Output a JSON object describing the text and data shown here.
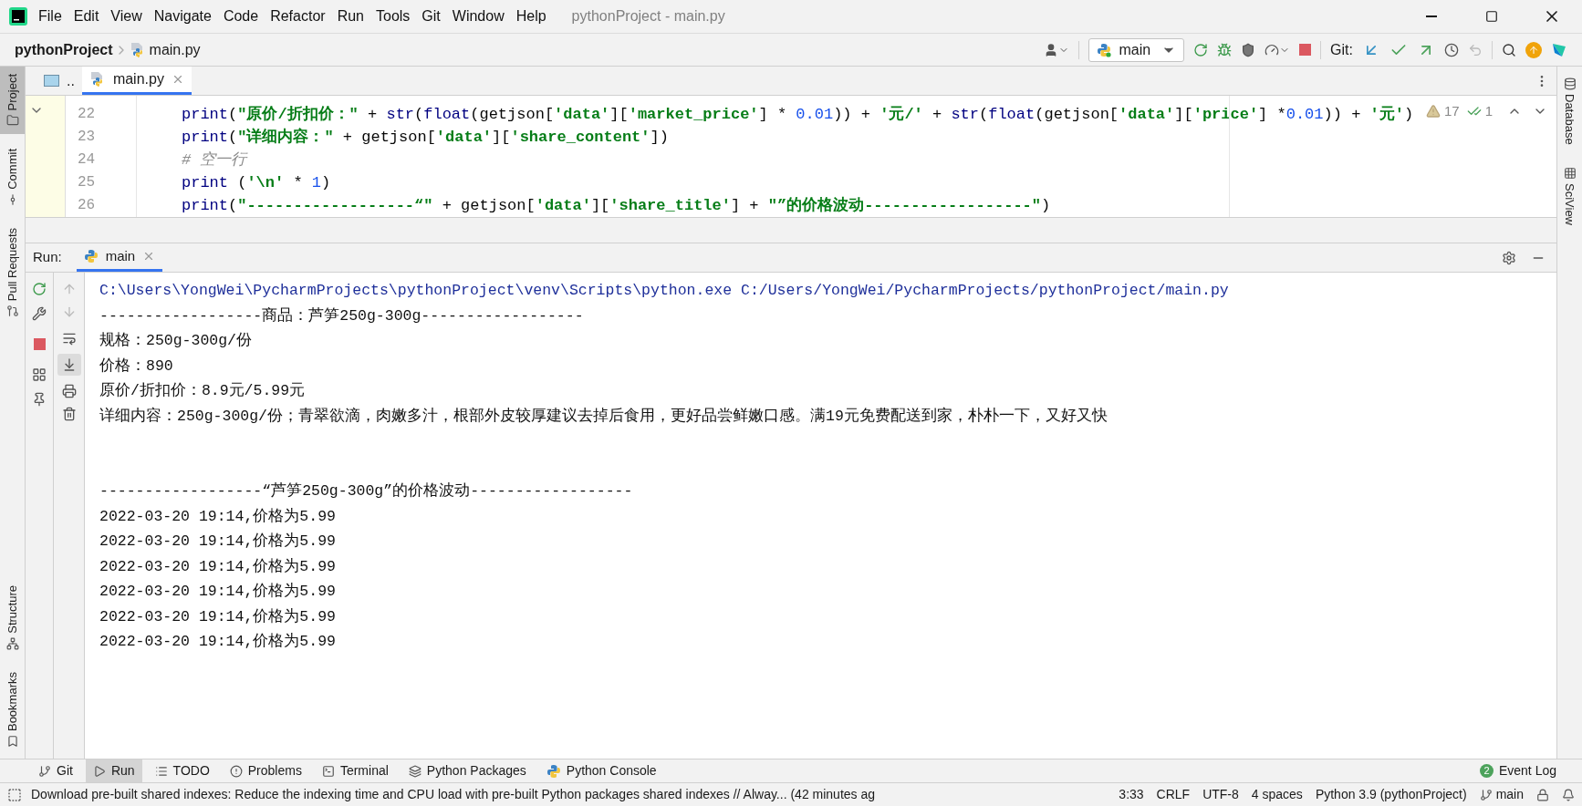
{
  "window": {
    "title": "pythonProject - main.py"
  },
  "menu": [
    "File",
    "Edit",
    "View",
    "Navigate",
    "Code",
    "Refactor",
    "Run",
    "Tools",
    "Git",
    "Window",
    "Help"
  ],
  "breadcrumb": {
    "project": "pythonProject",
    "file": "main.py"
  },
  "toolbar": {
    "run_config": "main",
    "git_label": "Git:"
  },
  "left_tool_windows": {
    "top": [
      {
        "label": "Project",
        "selected": true
      },
      {
        "label": "Commit",
        "selected": false
      },
      {
        "label": "Pull Requests",
        "selected": false
      }
    ],
    "bottom": [
      {
        "label": "Structure",
        "selected": false
      },
      {
        "label": "Bookmarks",
        "selected": false
      }
    ]
  },
  "right_tool_windows": [
    {
      "label": "Database"
    },
    {
      "label": "SciView"
    }
  ],
  "editor": {
    "tabs": [
      {
        "label": "..",
        "selected": false,
        "closable": false
      },
      {
        "label": "main.py",
        "selected": true,
        "closable": true
      }
    ],
    "inspections": {
      "warnings": "17",
      "typos": "1"
    },
    "lines": [
      {
        "number": "22",
        "tokens": [
          {
            "kind": "builtin",
            "text": "print"
          },
          {
            "kind": "plain",
            "text": "("
          },
          {
            "kind": "string",
            "text": "\"原价/折扣价：\""
          },
          {
            "kind": "plain",
            "text": " + "
          },
          {
            "kind": "builtin",
            "text": "str"
          },
          {
            "kind": "plain",
            "text": "("
          },
          {
            "kind": "builtin",
            "text": "float"
          },
          {
            "kind": "plain",
            "text": "(getjson["
          },
          {
            "kind": "string",
            "text": "'data'"
          },
          {
            "kind": "plain",
            "text": "]["
          },
          {
            "kind": "string",
            "text": "'market_price'"
          },
          {
            "kind": "plain",
            "text": "] * "
          },
          {
            "kind": "number",
            "text": "0.01"
          },
          {
            "kind": "plain",
            "text": ")) + "
          },
          {
            "kind": "string",
            "text": "'元/'"
          },
          {
            "kind": "plain",
            "text": " + "
          },
          {
            "kind": "builtin",
            "text": "str"
          },
          {
            "kind": "plain",
            "text": "("
          },
          {
            "kind": "builtin",
            "text": "float"
          },
          {
            "kind": "plain",
            "text": "(getjson["
          },
          {
            "kind": "string",
            "text": "'data'"
          },
          {
            "kind": "plain",
            "text": "]["
          },
          {
            "kind": "string",
            "text": "'price'"
          },
          {
            "kind": "plain",
            "text": "] *"
          },
          {
            "kind": "number",
            "text": "0.01"
          },
          {
            "kind": "plain",
            "text": ")) + "
          },
          {
            "kind": "string",
            "text": "'元'"
          },
          {
            "kind": "plain",
            "text": ")"
          }
        ]
      },
      {
        "number": "23",
        "tokens": [
          {
            "kind": "builtin",
            "text": "print"
          },
          {
            "kind": "plain",
            "text": "("
          },
          {
            "kind": "string",
            "text": "\"详细内容：\""
          },
          {
            "kind": "plain",
            "text": " + getjson["
          },
          {
            "kind": "string",
            "text": "'data'"
          },
          {
            "kind": "plain",
            "text": "]["
          },
          {
            "kind": "string",
            "text": "'share_content'"
          },
          {
            "kind": "plain",
            "text": "])"
          }
        ]
      },
      {
        "number": "24",
        "tokens": [
          {
            "kind": "comment",
            "text": "# 空一行"
          }
        ]
      },
      {
        "number": "25",
        "tokens": [
          {
            "kind": "builtin",
            "text": "print"
          },
          {
            "kind": "plain",
            "text": " ("
          },
          {
            "kind": "string",
            "text": "'\\n'"
          },
          {
            "kind": "plain",
            "text": " * "
          },
          {
            "kind": "number",
            "text": "1"
          },
          {
            "kind": "plain",
            "text": ")"
          }
        ]
      },
      {
        "number": "26",
        "tokens": [
          {
            "kind": "builtin",
            "text": "print"
          },
          {
            "kind": "plain",
            "text": "("
          },
          {
            "kind": "string",
            "text": "\"------------------“\""
          },
          {
            "kind": "plain",
            "text": " + getjson["
          },
          {
            "kind": "string",
            "text": "'data'"
          },
          {
            "kind": "plain",
            "text": "]["
          },
          {
            "kind": "string",
            "text": "'share_title'"
          },
          {
            "kind": "plain",
            "text": "] + "
          },
          {
            "kind": "string",
            "text": "\"”的价格波动------------------\""
          },
          {
            "kind": "plain",
            "text": ")"
          }
        ]
      }
    ]
  },
  "run": {
    "label": "Run:",
    "tabs": [
      {
        "label": "main",
        "selected": true
      }
    ],
    "output_blocks": [
      {
        "lines": [
          {
            "kind": "command",
            "text": "C:\\Users\\YongWei\\PycharmProjects\\pythonProject\\venv\\Scripts\\python.exe C:/Users/YongWei/PycharmProjects/pythonProject/main.py"
          },
          {
            "kind": "stdout",
            "text": "------------------商品：芦笋250g-300g------------------"
          },
          {
            "kind": "stdout",
            "text": "规格：250g-300g/份"
          },
          {
            "kind": "stdout",
            "text": "价格：890"
          },
          {
            "kind": "stdout",
            "text": "原价/折扣价：8.9元/5.99元"
          },
          {
            "kind": "stdout",
            "text": "详细内容：250g-300g/份；青翠欲滴，肉嫩多汁，根部外皮较厚建议去掉后食用，更好品尝鲜嫩口感。满19元免费配送到家，朴朴一下，又好又快"
          }
        ]
      },
      {
        "lines": [
          {
            "kind": "stdout",
            "text": "------------------“芦笋250g-300g”的价格波动------------------"
          },
          {
            "kind": "stdout",
            "text": "2022-03-20 19:14,价格为5.99"
          },
          {
            "kind": "stdout",
            "text": "2022-03-20 19:14,价格为5.99"
          },
          {
            "kind": "stdout",
            "text": "2022-03-20 19:14,价格为5.99"
          },
          {
            "kind": "stdout",
            "text": "2022-03-20 19:14,价格为5.99"
          },
          {
            "kind": "stdout",
            "text": "2022-03-20 19:14,价格为5.99"
          },
          {
            "kind": "stdout",
            "text": "2022-03-20 19:14,价格为5.99"
          }
        ]
      }
    ]
  },
  "bottom_tabs": [
    {
      "label": "Git",
      "kind": "git",
      "selected": false
    },
    {
      "label": "Run",
      "kind": "run",
      "selected": true
    },
    {
      "label": "TODO",
      "kind": "todo",
      "selected": false
    },
    {
      "label": "Problems",
      "kind": "problems",
      "selected": false
    },
    {
      "label": "Terminal",
      "kind": "terminal",
      "selected": false
    },
    {
      "label": "Python Packages",
      "kind": "packages",
      "selected": false
    },
    {
      "label": "Python Console",
      "kind": "console",
      "selected": false
    }
  ],
  "event_log": {
    "label": "Event Log",
    "count": "2"
  },
  "status_bar": {
    "message": "Download pre-built shared indexes: Reduce the indexing time and CPU load with pre-built Python packages shared indexes // Alway... (42 minutes ag",
    "items": [
      "3:33",
      "CRLF",
      "UTF-8",
      "4 spaces",
      "Python 3.9 (pythonProject)"
    ],
    "branch": "main"
  }
}
